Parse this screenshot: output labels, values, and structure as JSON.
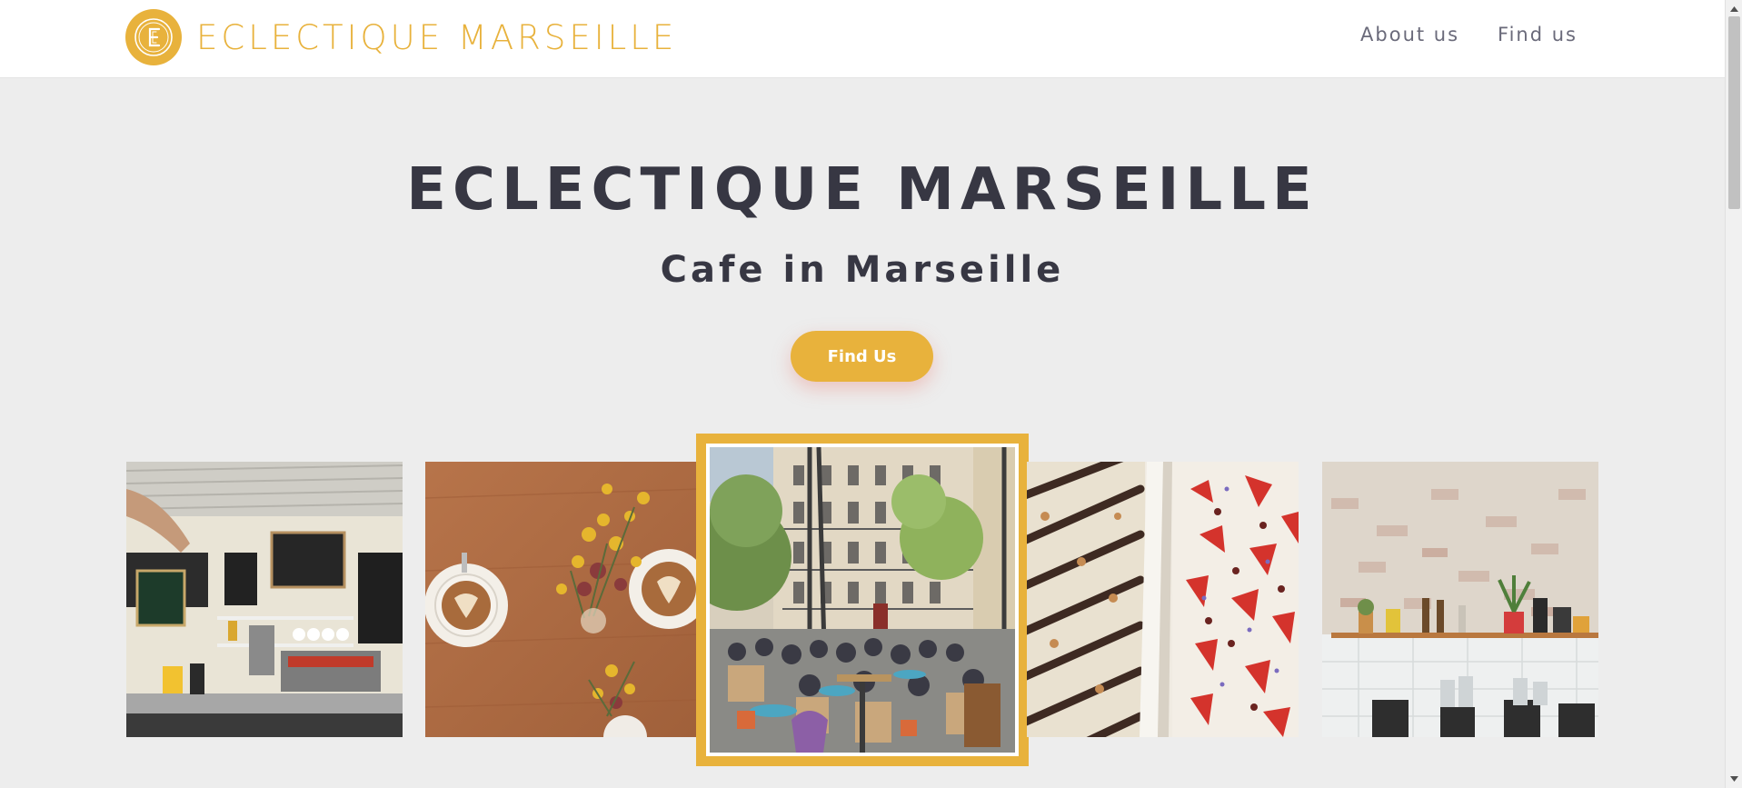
{
  "brand": {
    "name": "ECLECTIQUE MARSEILLE",
    "logo_icon": "letter-e-logo-icon",
    "color": "#e8b23c"
  },
  "nav": {
    "items": [
      {
        "label": "About us"
      },
      {
        "label": "Find us"
      }
    ]
  },
  "hero": {
    "title": "ECLECTIQUE MARSEILLE",
    "subtitle": "Cafe in Marseille",
    "cta_label": "Find Us"
  },
  "gallery": {
    "photos": [
      {
        "name": "cafe-counter-photo"
      },
      {
        "name": "coffee-and-flowers-photo"
      },
      {
        "name": "terrace-square-photo",
        "featured": true
      },
      {
        "name": "chocolate-bark-photo"
      },
      {
        "name": "brick-wall-shelf-photo"
      }
    ]
  },
  "colors": {
    "accent": "#e8b23c",
    "heading": "#373743",
    "nav_text": "#6a6a7a",
    "background": "#ededed"
  }
}
